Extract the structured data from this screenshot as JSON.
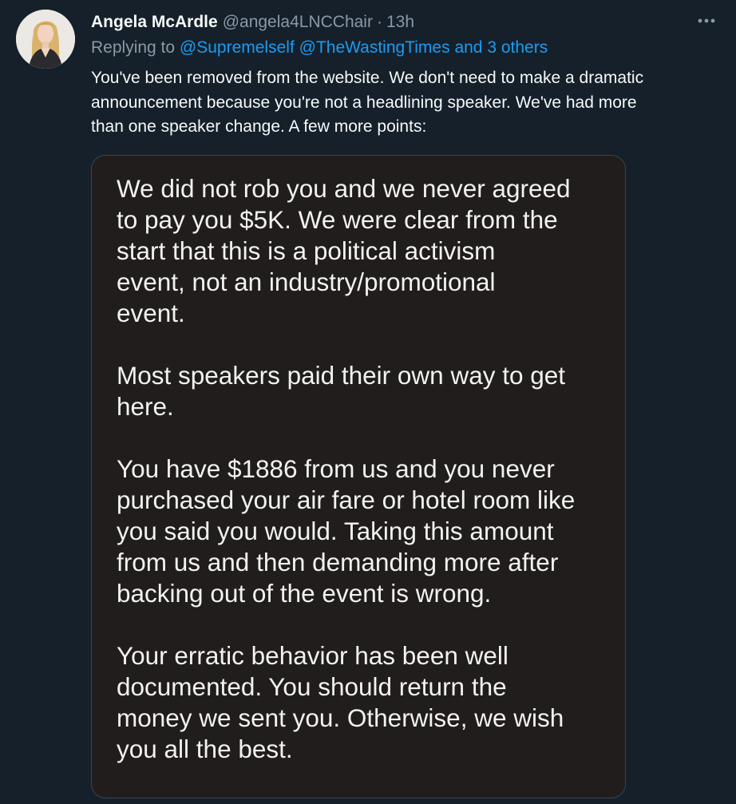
{
  "tweet": {
    "display_name": "Angela McArdle",
    "handle": "@angela4LNCChair",
    "separator": "·",
    "time": "13h",
    "more_icon": "more-horizontal-icon",
    "avatar_icon": "avatar-photo",
    "replying_prefix": "Replying to",
    "mentions": [
      "@Supremelself",
      "@TheWastingTimes"
    ],
    "replying_connector": "and",
    "replying_others": "3 others",
    "text_lines": [
      "You've been removed from the website. We don't need to make a dramatic",
      "announcement because you're not a headlining speaker. We've had more",
      "than one speaker change. A few more points:"
    ]
  },
  "media": {
    "paragraphs": [
      [
        "We did not rob you and we never agreed",
        "to pay you $5K. We were clear from the",
        "start that this is a political activism",
        "event, not an industry/promotional",
        "event."
      ],
      [
        "Most speakers paid their own way to get",
        "here."
      ],
      [
        "You have $1886 from us and you never",
        "purchased your air fare or hotel room like",
        "you said you would. Taking this amount",
        "from us and then demanding more after",
        "backing out of the event is wrong."
      ],
      [
        "Your erratic behavior has been well",
        "documented. You should return the",
        "money we sent you. Otherwise, we wish",
        "you all the best."
      ]
    ]
  },
  "colors": {
    "background": "#15202b",
    "primary_text": "#f7f9f9",
    "secondary_text": "#8b98a5",
    "link": "#1d9bf0",
    "media_background": "#211d1c"
  }
}
